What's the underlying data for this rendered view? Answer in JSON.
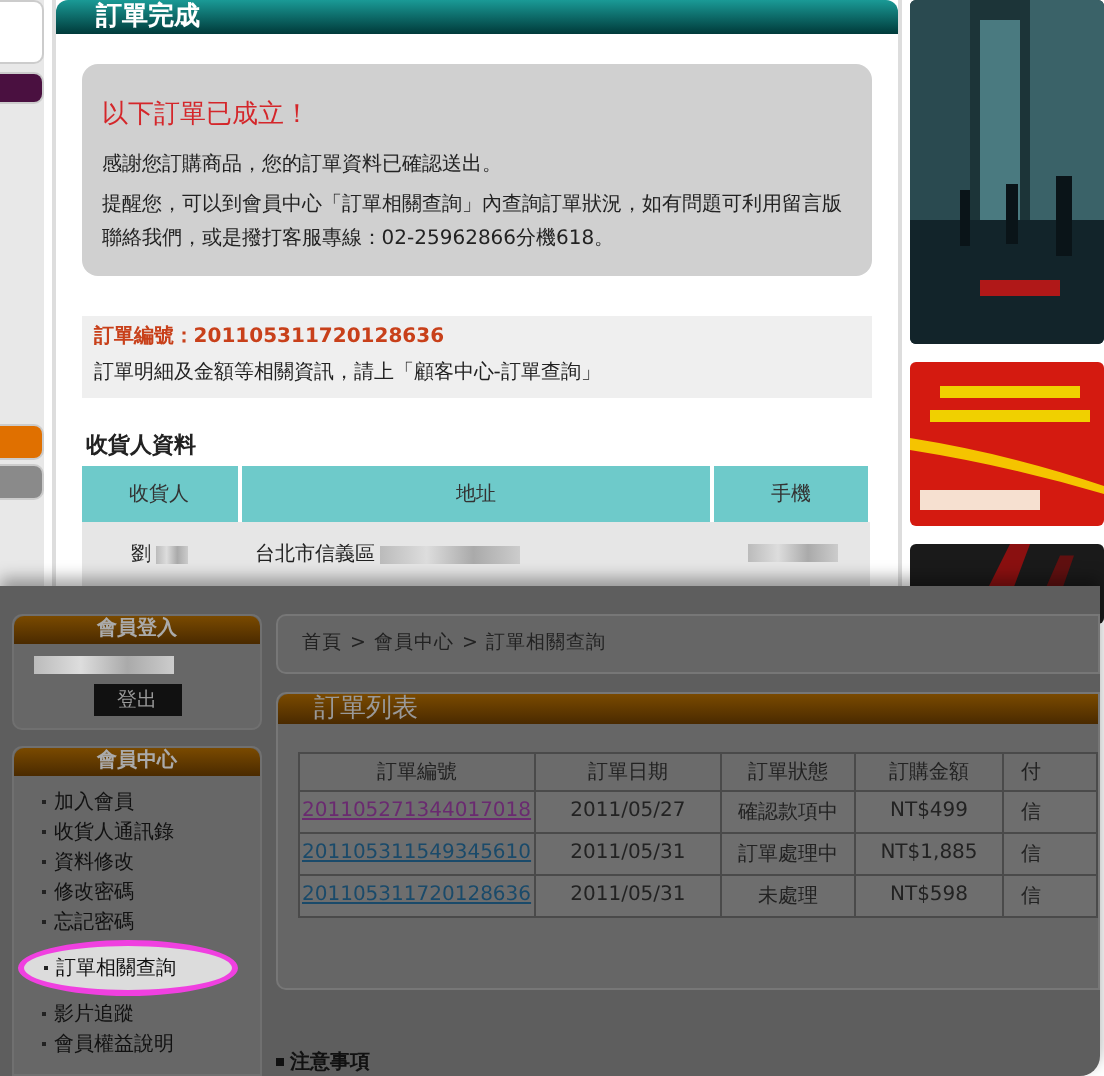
{
  "order_complete": {
    "title": "訂單完成",
    "notice": {
      "heading": "以下訂單已成立！",
      "lines": [
        "感謝您訂購商品，您的訂單資料已確認送出。",
        "提醒您，可以到會員中心「訂單相關查詢」內查詢訂單狀況，如有問題可利用留言版聯絡我們，或是撥打客服專線：02-25962866分機618。"
      ]
    },
    "order_info": {
      "number_label": "訂單編號：",
      "number": "201105311720128636",
      "note": "訂單明細及金額等相關資訊，請上「顧客中心-訂單查詢」"
    },
    "consignee": {
      "title": "收貨人資料",
      "columns": [
        "收貨人",
        "地址",
        "手機"
      ],
      "row": {
        "name": "劉",
        "address": "台北市信義區"
      }
    }
  },
  "side_tabs": [
    {
      "color": "#ffffff"
    },
    {
      "color": "#4a1040"
    },
    {
      "color": "#e07000"
    },
    {
      "color": "#8a8a8a"
    }
  ],
  "posters": [
    {
      "kind": "picture"
    },
    {
      "kind": "picture"
    },
    {
      "kind": "picture"
    }
  ],
  "member_sidebar": {
    "login": {
      "title": "會員登入",
      "logout_button": "登出"
    },
    "member_center": {
      "title": "會員中心",
      "items": [
        {
          "label": "加入會員",
          "selected": false
        },
        {
          "label": "收貨人通訊錄",
          "selected": false
        },
        {
          "label": "資料修改",
          "selected": false
        },
        {
          "label": "修改密碼",
          "selected": false
        },
        {
          "label": "忘記密碼",
          "selected": false
        },
        {
          "label": "訂單相關查詢",
          "selected": true
        },
        {
          "label": "影片追蹤",
          "selected": false
        },
        {
          "label": "會員權益說明",
          "selected": false
        }
      ]
    }
  },
  "breadcrumb": [
    "首頁",
    "會員中心",
    "訂單相關查詢"
  ],
  "breadcrumb_separator": ">",
  "order_list": {
    "title": "訂單列表",
    "columns": [
      "訂單編號",
      "訂單日期",
      "訂單狀態",
      "訂購金額",
      "付"
    ],
    "rows": [
      {
        "number": "201105271344017018",
        "visited": true,
        "date": "2011/05/27",
        "status": "確認款項中",
        "amount": "NT$499",
        "column_5": "信"
      },
      {
        "number": "201105311549345610",
        "visited": false,
        "date": "2011/05/31",
        "status": "訂單處理中",
        "amount": "NT$1,885",
        "column_5": "信"
      },
      {
        "number": "201105311720128636",
        "visited": false,
        "date": "2011/05/31",
        "status": "未處理",
        "amount": "NT$598",
        "column_5": "信"
      }
    ]
  },
  "notes": {
    "title": "注意事項"
  }
}
